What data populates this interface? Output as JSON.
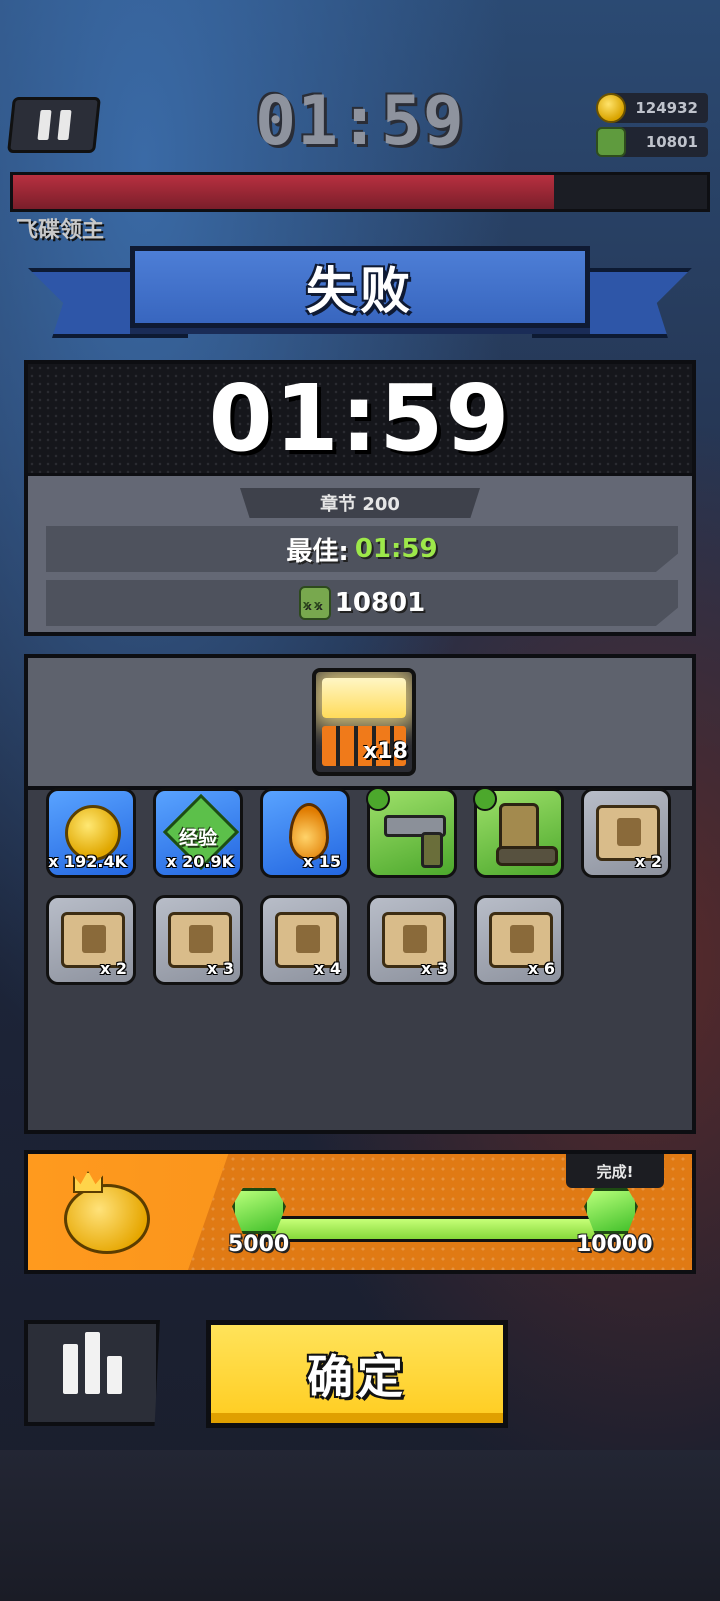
{
  "hud": {
    "timer": "01:59",
    "gold": "124932",
    "kills": "10801",
    "boss_name": "飞碟领主",
    "boss_health_fraction": 0.78
  },
  "result": {
    "title": "失败",
    "time": "01:59",
    "chapter": "章节 200",
    "best_label": "最佳:",
    "best_value": "01:59",
    "kills": "10801"
  },
  "rewards": {
    "chest_qty": "x18",
    "items": [
      {
        "name": "coin",
        "qty": "x 192.4K"
      },
      {
        "name": "exp",
        "label": "经验",
        "qty": "x 20.9K"
      },
      {
        "name": "drop",
        "qty": "x 15"
      },
      {
        "name": "revolver",
        "qty": ""
      },
      {
        "name": "boot",
        "qty": ""
      },
      {
        "name": "scroll-gun",
        "qty": "x 2"
      },
      {
        "name": "scroll-armor",
        "qty": "x 2"
      },
      {
        "name": "scroll-necklace",
        "qty": "x 3"
      },
      {
        "name": "scroll-belt",
        "qty": "x 4"
      },
      {
        "name": "scroll-glove",
        "qty": "x 3"
      },
      {
        "name": "scroll-boot",
        "qty": "x 6"
      }
    ]
  },
  "piggy": {
    "done_label": "完成!",
    "min_value": "5000",
    "max_value": "10000",
    "progress_fraction": 1.0
  },
  "buttons": {
    "confirm": "确定"
  },
  "colors": {
    "banner_blue": "#3866bf",
    "best_green": "#9de84a",
    "confirm_yellow": "#ffcc1f",
    "piggy_orange": "#f08a18"
  }
}
